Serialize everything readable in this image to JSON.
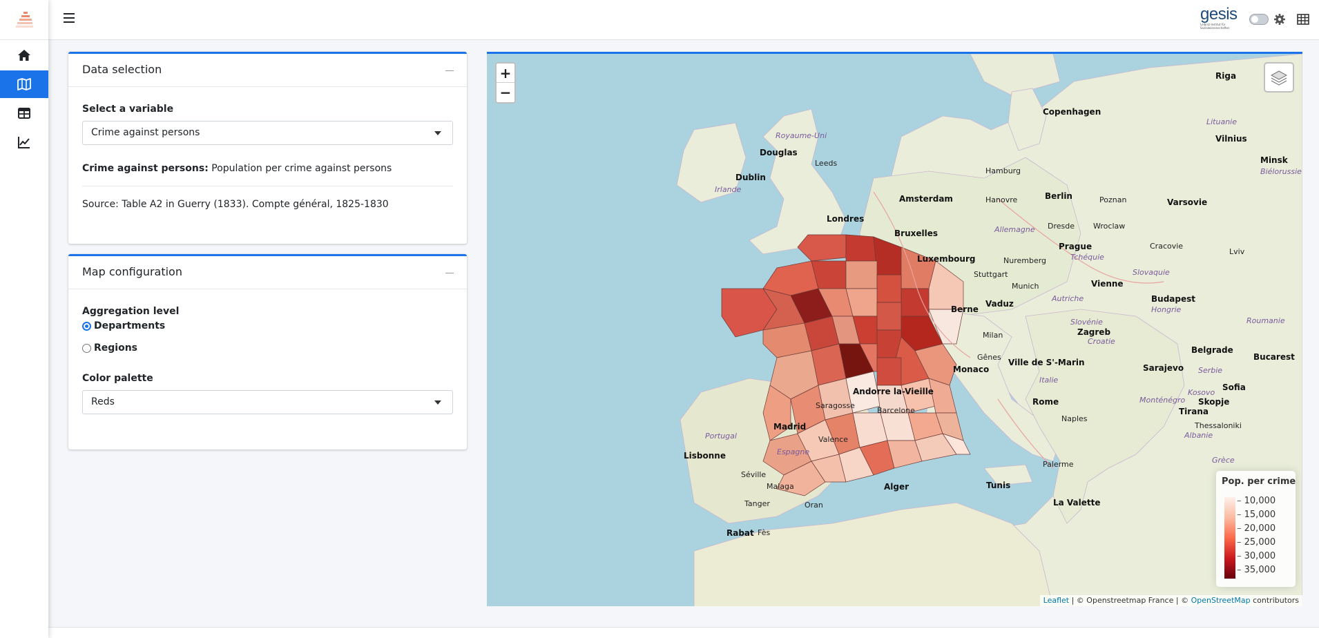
{
  "nav": {
    "items": [
      {
        "name": "home",
        "icon": "home-icon"
      },
      {
        "name": "map",
        "icon": "map-icon",
        "active": true
      },
      {
        "name": "table",
        "icon": "table-icon"
      },
      {
        "name": "chart",
        "icon": "chart-line-icon"
      }
    ]
  },
  "header": {
    "logo_text": "gesis",
    "logo_subtitle": "Leibniz-Institut für Sozialwissenschaften"
  },
  "data_selection": {
    "title": "Data selection",
    "variable_label": "Select a variable",
    "variable_value": "Crime against persons",
    "description_term": "Crime against persons:",
    "description_text": " Population per crime against persons",
    "source": "Source: Table A2 in Guerry (1833). Compte général, 1825-1830"
  },
  "map_config": {
    "title": "Map configuration",
    "aggregation_label": "Aggregation level",
    "aggregation_options": [
      "Departments",
      "Regions"
    ],
    "aggregation_selected": "Departments",
    "palette_label": "Color palette",
    "palette_value": "Reds"
  },
  "map": {
    "zoom_in": "+",
    "zoom_out": "−",
    "legend_title": "Pop. per crime",
    "legend_ticks": [
      "10,000",
      "15,000",
      "20,000",
      "25,000",
      "30,000",
      "35,000"
    ],
    "attribution_leaflet": "Leaflet",
    "attribution_text1": " | © Openstreetmap France | © ",
    "attribution_osm": "OpenStreetMap",
    "attribution_text2": " contributors",
    "cities": [
      {
        "name": "Copenhagen",
        "bold": true
      },
      {
        "name": "Riga",
        "bold": true
      },
      {
        "name": "Vilnius",
        "bold": true
      },
      {
        "name": "Minsk",
        "bold": true
      },
      {
        "name": "Douglas",
        "bold": true
      },
      {
        "name": "Dublin",
        "bold": true
      },
      {
        "name": "Leeds",
        "bold": false
      },
      {
        "name": "Hamburg",
        "bold": false
      },
      {
        "name": "Berlin",
        "bold": true
      },
      {
        "name": "Poznan",
        "bold": false
      },
      {
        "name": "Varsovie",
        "bold": true
      },
      {
        "name": "Amsterdam",
        "bold": true
      },
      {
        "name": "Hanovre",
        "bold": false
      },
      {
        "name": "Londres",
        "bold": true
      },
      {
        "name": "Bruxelles",
        "bold": true
      },
      {
        "name": "Dresde",
        "bold": false
      },
      {
        "name": "Wroclaw",
        "bold": false
      },
      {
        "name": "Prague",
        "bold": true
      },
      {
        "name": "Cracovie",
        "bold": false
      },
      {
        "name": "Luxembourg",
        "bold": true
      },
      {
        "name": "Lviv",
        "bold": false
      },
      {
        "name": "Stuttgart",
        "bold": false
      },
      {
        "name": "Nuremberg",
        "bold": false
      },
      {
        "name": "Munich",
        "bold": false
      },
      {
        "name": "Vienne",
        "bold": true
      },
      {
        "name": "Vaduz",
        "bold": true
      },
      {
        "name": "Budapest",
        "bold": true
      },
      {
        "name": "Berne",
        "bold": true
      },
      {
        "name": "Milan",
        "bold": false
      },
      {
        "name": "Zagreb",
        "bold": true
      },
      {
        "name": "Belgrade",
        "bold": true
      },
      {
        "name": "Bucarest",
        "bold": true
      },
      {
        "name": "Gênes",
        "bold": false
      },
      {
        "name": "Ville de S'-Marin",
        "bold": true
      },
      {
        "name": "Monaco",
        "bold": true
      },
      {
        "name": "Sarajevo",
        "bold": true
      },
      {
        "name": "Sofia",
        "bold": true
      },
      {
        "name": "Andorre la-Vieille",
        "bold": true
      },
      {
        "name": "Saragosse",
        "bold": false
      },
      {
        "name": "Barcelone",
        "bold": false
      },
      {
        "name": "Rome",
        "bold": true
      },
      {
        "name": "Skopje",
        "bold": true
      },
      {
        "name": "Madrid",
        "bold": true
      },
      {
        "name": "Tirana",
        "bold": true
      },
      {
        "name": "Naples",
        "bold": false
      },
      {
        "name": "Valence",
        "bold": false
      },
      {
        "name": "Lisbonne",
        "bold": true
      },
      {
        "name": "Palerme",
        "bold": false
      },
      {
        "name": "Séville",
        "bold": false
      },
      {
        "name": "Malaga",
        "bold": false
      },
      {
        "name": "Alger",
        "bold": true
      },
      {
        "name": "Tunis",
        "bold": true
      },
      {
        "name": "La Valette",
        "bold": true
      },
      {
        "name": "Tanger",
        "bold": false
      },
      {
        "name": "Oran",
        "bold": false
      },
      {
        "name": "Rabat",
        "bold": true
      },
      {
        "name": "Fès",
        "bold": false
      },
      {
        "name": "Thessaloniki",
        "bold": false
      }
    ],
    "regions": [
      {
        "name": "Royaume-Uni"
      },
      {
        "name": "Irlande"
      },
      {
        "name": "Allemagne"
      },
      {
        "name": "Tchéquie"
      },
      {
        "name": "Slovaquie"
      },
      {
        "name": "Autriche"
      },
      {
        "name": "Hongrie"
      },
      {
        "name": "Slovénie"
      },
      {
        "name": "Croatie"
      },
      {
        "name": "Roumanie"
      },
      {
        "name": "Serbie"
      },
      {
        "name": "Monténégro"
      },
      {
        "name": "Kosovo"
      },
      {
        "name": "Albanie"
      },
      {
        "name": "Italie"
      },
      {
        "name": "Espagne"
      },
      {
        "name": "Portugal"
      },
      {
        "name": "Lituanie"
      },
      {
        "name": "Biélorussie"
      },
      {
        "name": "Grèce"
      }
    ]
  }
}
